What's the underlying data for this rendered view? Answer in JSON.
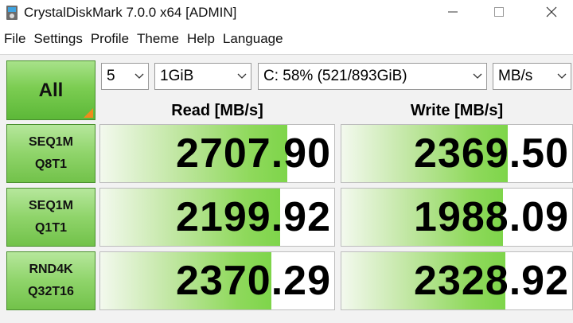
{
  "window": {
    "title": "CrystalDiskMark 7.0.0 x64 [ADMIN]",
    "icon": "crystaldiskmark-app-icon"
  },
  "menu": [
    "File",
    "Settings",
    "Profile",
    "Theme",
    "Help",
    "Language"
  ],
  "controls": {
    "all_label": "All",
    "test_count": "5",
    "test_size": "1GiB",
    "drive": "C: 58% (521/893GiB)",
    "unit": "MB/s"
  },
  "headers": {
    "read": "Read [MB/s]",
    "write": "Write [MB/s]"
  },
  "rows": [
    {
      "label_line1": "SEQ1M",
      "label_line2": "Q8T1",
      "read": "2707.90",
      "write": "2369.50",
      "read_fill": 0.8,
      "write_fill": 0.72
    },
    {
      "label_line1": "SEQ1M",
      "label_line2": "Q1T1",
      "read": "2199.92",
      "write": "1988.09",
      "read_fill": 0.77,
      "write_fill": 0.7
    },
    {
      "label_line1": "RND4K",
      "label_line2": "Q32T16",
      "read": "2370.29",
      "write": "2328.92",
      "read_fill": 0.73,
      "write_fill": 0.71
    }
  ],
  "colors": {
    "accent_green": "#7ed54a",
    "corner_orange": "#f08a1d"
  }
}
